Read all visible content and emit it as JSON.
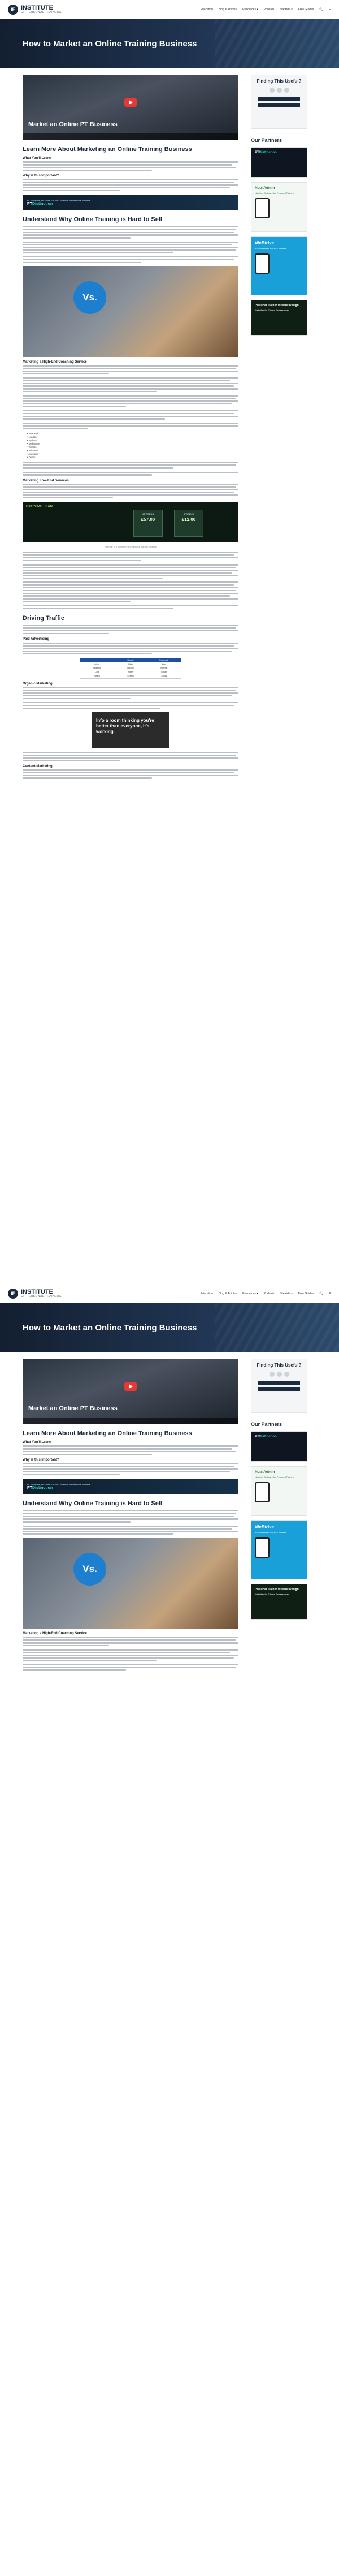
{
  "site": {
    "logo_mark": "IF",
    "logo_title": "INSTITUTE",
    "logo_subtitle": "OF PERSONAL TRAINERS"
  },
  "nav": {
    "items": [
      "Education",
      "Blog & Articles",
      "Resources ▾",
      "Podcast",
      "Sitewide ▾",
      "Free Guides"
    ]
  },
  "hero": {
    "title": "How to Market an Online Training Business"
  },
  "video": {
    "title": "Market an Online PT Business"
  },
  "article": {
    "h_learn": "Learn More About Marketing an Online Training Business",
    "h_what": "What You'll Learn",
    "h_why": "Why is this Important?",
    "banner_text": "PT Solutions and Done-For-You Software for Personal Trainers",
    "banner_logo_a": "PT",
    "banner_logo_b": "Distinction",
    "h_understand": "Understand Why Online Training is Hard to Sell",
    "vs_label": "Vs.",
    "h_marketing_mistake": "Marketing a High-End Coaching Service",
    "cities": [
      "New York",
      "London",
      "Sydney",
      "Melbourne",
      "Toronto",
      "Brisbane",
      "Auckland",
      "Dublin"
    ],
    "h_avoid": "Marketing Low-End Services",
    "pricing_brand": "EXTREME LEAN",
    "pricing_cards": [
      {
        "name": "12 WEEKS",
        "price": "£57.00"
      },
      {
        "name": "6 WEEKS",
        "price": "£12.00"
      }
    ],
    "pricing_caption": "Example of a low-end online personal training package",
    "h_traffic": "Driving Traffic",
    "h_paid": "Paid Advertising",
    "table_headers": [
      "",
      "Google",
      "Facebook"
    ],
    "table_rows": [
      [
        "Intent",
        "High",
        "Low"
      ],
      [
        "Targeting",
        "Keyword",
        "Interest"
      ],
      [
        "Cost",
        "Higher",
        "Lower"
      ],
      [
        "Reach",
        "Search",
        "Social"
      ]
    ],
    "h_organic": "Organic Marketing",
    "meme_text": "Info a room thinking you're better than everyone, it's working.",
    "h_content": "Content Marketing"
  },
  "sidebar": {
    "find_title": "Finding This Useful?",
    "partners_title": "Our Partners",
    "ad1_a": "PT",
    "ad1_b": "Distinction",
    "ad2_title": "NutriAdmin",
    "ad2_sub": "Nutrition Software for Personal Trainers",
    "ad3_title": "WeStrive",
    "ad3_sub": "Accountability App for Coaches",
    "ad4_title": "Personal Trainer Website Design",
    "ad4_sub": "Websites for Fitness Professionals"
  }
}
